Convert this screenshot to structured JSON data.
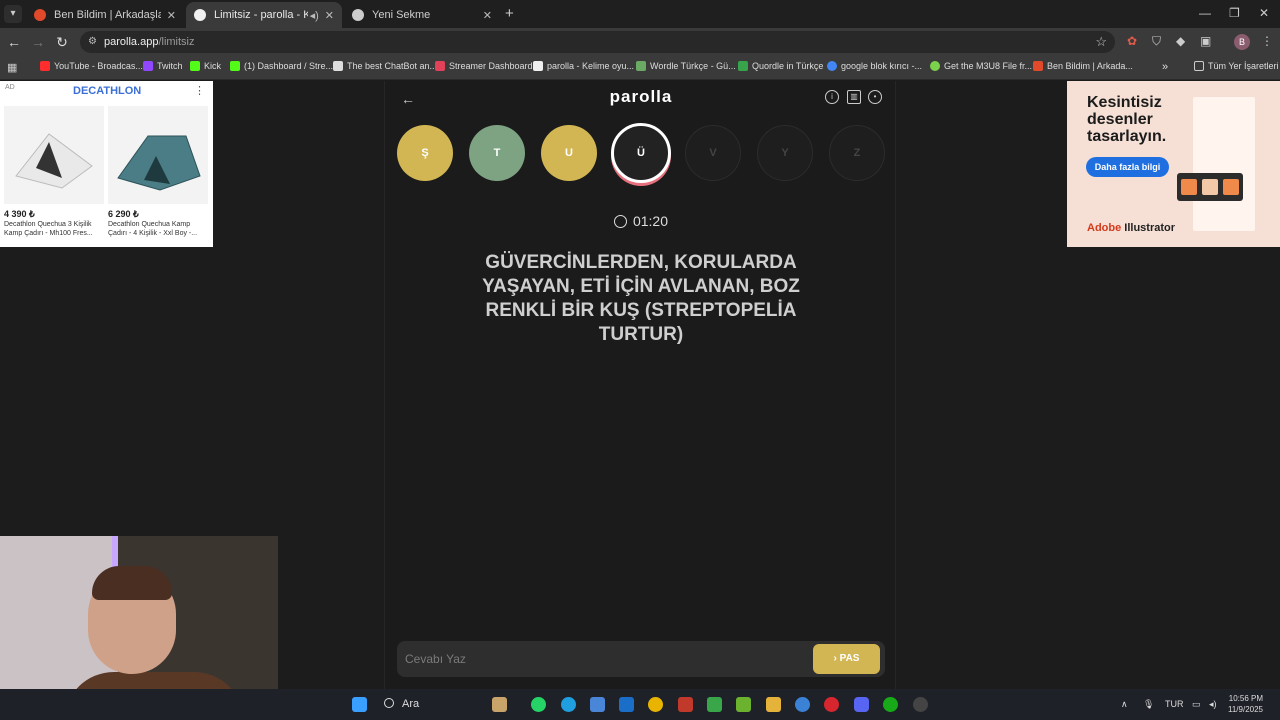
{
  "tabs": [
    {
      "title": "Ben Bildim | Arkadaşlarınla Onl",
      "favicon_color": "#e04a2a",
      "active": false
    },
    {
      "title": "Limitsiz - parolla - Kelime o",
      "favicon_color": "#f0f0f0",
      "active": true
    },
    {
      "title": "Yeni Sekme",
      "favicon_color": "#cccccc",
      "active": false
    }
  ],
  "toolbar": {
    "url_host": "parolla.app",
    "url_path": "/limitsiz"
  },
  "bookmarks": [
    {
      "label": "YouTube - Broadcas...",
      "color": "#ff2d2d"
    },
    {
      "label": "Twitch",
      "color": "#9146ff"
    },
    {
      "label": "Kick",
      "color": "#53fc18"
    },
    {
      "label": "(1) Dashboard / Stre...",
      "color": "#53fc18"
    },
    {
      "label": "The best ChatBot an...",
      "color": "#dddddd"
    },
    {
      "label": "Streamer Dashboard",
      "color": "#e2415a"
    },
    {
      "label": "parolla - Kelime oyu...",
      "color": "#f0f0f0"
    },
    {
      "label": "Wordle Türkçe - Gü...",
      "color": "#6aaa64"
    },
    {
      "label": "Quordle in Türkçe",
      "color": "#37a34a"
    },
    {
      "label": "google blok kırıcı -...",
      "color": "#4285f4"
    },
    {
      "label": "Get the M3U8 File fr...",
      "color": "#7bd34c"
    },
    {
      "label": "Ben Bildim | Arkada...",
      "color": "#e04a2a"
    }
  ],
  "bookmarks_all": "Tüm Yer İşaretleri",
  "ad_left": {
    "tag": "AD",
    "brand": "DECATHLON",
    "products": [
      {
        "price": "4 390 ₺",
        "name": "Decathlon Quechua 3 Kişilik Kamp Çadırı - Mh100 Fres..."
      },
      {
        "price": "6 290 ₺",
        "name": "Decathlon Quechua Kamp Çadırı - 4 Kişilik - Xxl Boy -..."
      }
    ]
  },
  "ad_right": {
    "headline_1": "Kesintisiz",
    "headline_2": "desenler",
    "headline_3": "tasarlayın.",
    "cta": "Daha fazla bilgi",
    "brand_a": "Adobe",
    "brand_b": " Illustrator"
  },
  "app": {
    "logo": "parolla",
    "letters": [
      {
        "char": "Ş",
        "state": "gold"
      },
      {
        "char": "T",
        "state": "green"
      },
      {
        "char": "U",
        "state": "gold"
      },
      {
        "char": "Ü",
        "state": "active"
      },
      {
        "char": "V",
        "state": "pending"
      },
      {
        "char": "Y",
        "state": "pending"
      },
      {
        "char": "Z",
        "state": "pending"
      }
    ],
    "timer": "01:20",
    "question": "GÜVERCİNLERDEN, KORULARDA YAŞAYAN, ETİ İÇİN AVLANAN, BOZ RENKLİ BİR KUŞ (STREPTOPELİA TURTUR)",
    "answer_placeholder": "Cevabı Yaz",
    "pass_label": "PAS"
  },
  "taskbar": {
    "search_label": "Ara",
    "lang": "TUR",
    "time": "10:56 PM",
    "date": "11/9/2025"
  },
  "colors": {
    "gold": "#d3b654",
    "green": "#7ea383",
    "active_ring": "#e6707d"
  }
}
